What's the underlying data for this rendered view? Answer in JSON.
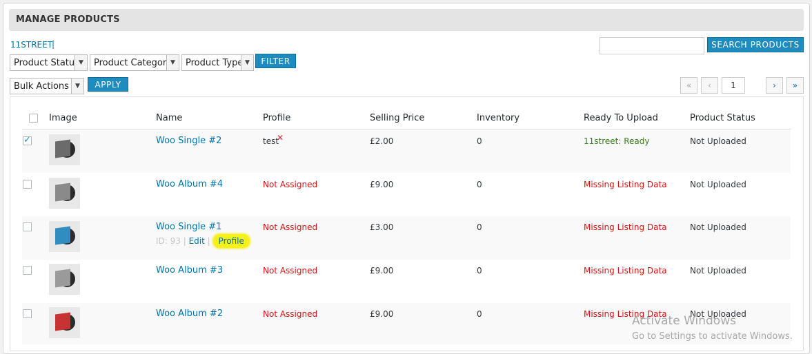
{
  "header": {
    "title": "MANAGE PRODUCTS"
  },
  "store_link": "11STREET",
  "store_sep": "|",
  "filters": {
    "status": "Product Status",
    "category": "Product Category",
    "type": "Product Type",
    "filter_label": "FILTER"
  },
  "bulk": {
    "label": "Bulk Actions",
    "apply_label": "APPLY"
  },
  "search": {
    "value": "",
    "button_label": "SEARCH PRODUCTS"
  },
  "pagination": {
    "first": "«",
    "prev": "‹",
    "page": "1",
    "next": "›",
    "last": "»"
  },
  "table": {
    "columns": [
      "Image",
      "Name",
      "Profile",
      "Selling Price",
      "Inventory",
      "Ready To Upload",
      "Product Status"
    ],
    "rows": [
      {
        "name": "Woo Single #2",
        "profile": "test",
        "price": "£2.00",
        "inventory": "0",
        "ready": "11street: Ready",
        "status": "Not Uploaded"
      },
      {
        "name": "Woo Album #4",
        "profile": "Not Assigned",
        "price": "£9.00",
        "inventory": "0",
        "ready": "Missing Listing Data",
        "status": "Not Uploaded"
      },
      {
        "name": "Woo Single #1",
        "profile": "Not Assigned",
        "price": "£3.00",
        "inventory": "0",
        "ready": "Missing Listing Data",
        "status": "Not Uploaded",
        "id_text": "ID: 93 |",
        "edit": "Edit",
        "sep": "|",
        "profile_action": "Profile"
      },
      {
        "name": "Woo Album #3",
        "profile": "Not Assigned",
        "price": "£9.00",
        "inventory": "0",
        "ready": "Missing Listing Data",
        "status": "Not Uploaded"
      },
      {
        "name": "Woo Album #2",
        "profile": "Not Assigned",
        "price": "£9.00",
        "inventory": "0",
        "ready": "Missing Listing Data",
        "status": "Not Uploaded"
      }
    ]
  },
  "watermark": {
    "line1": "Activate Windows",
    "line2": "Go to Settings to activate Windows."
  }
}
